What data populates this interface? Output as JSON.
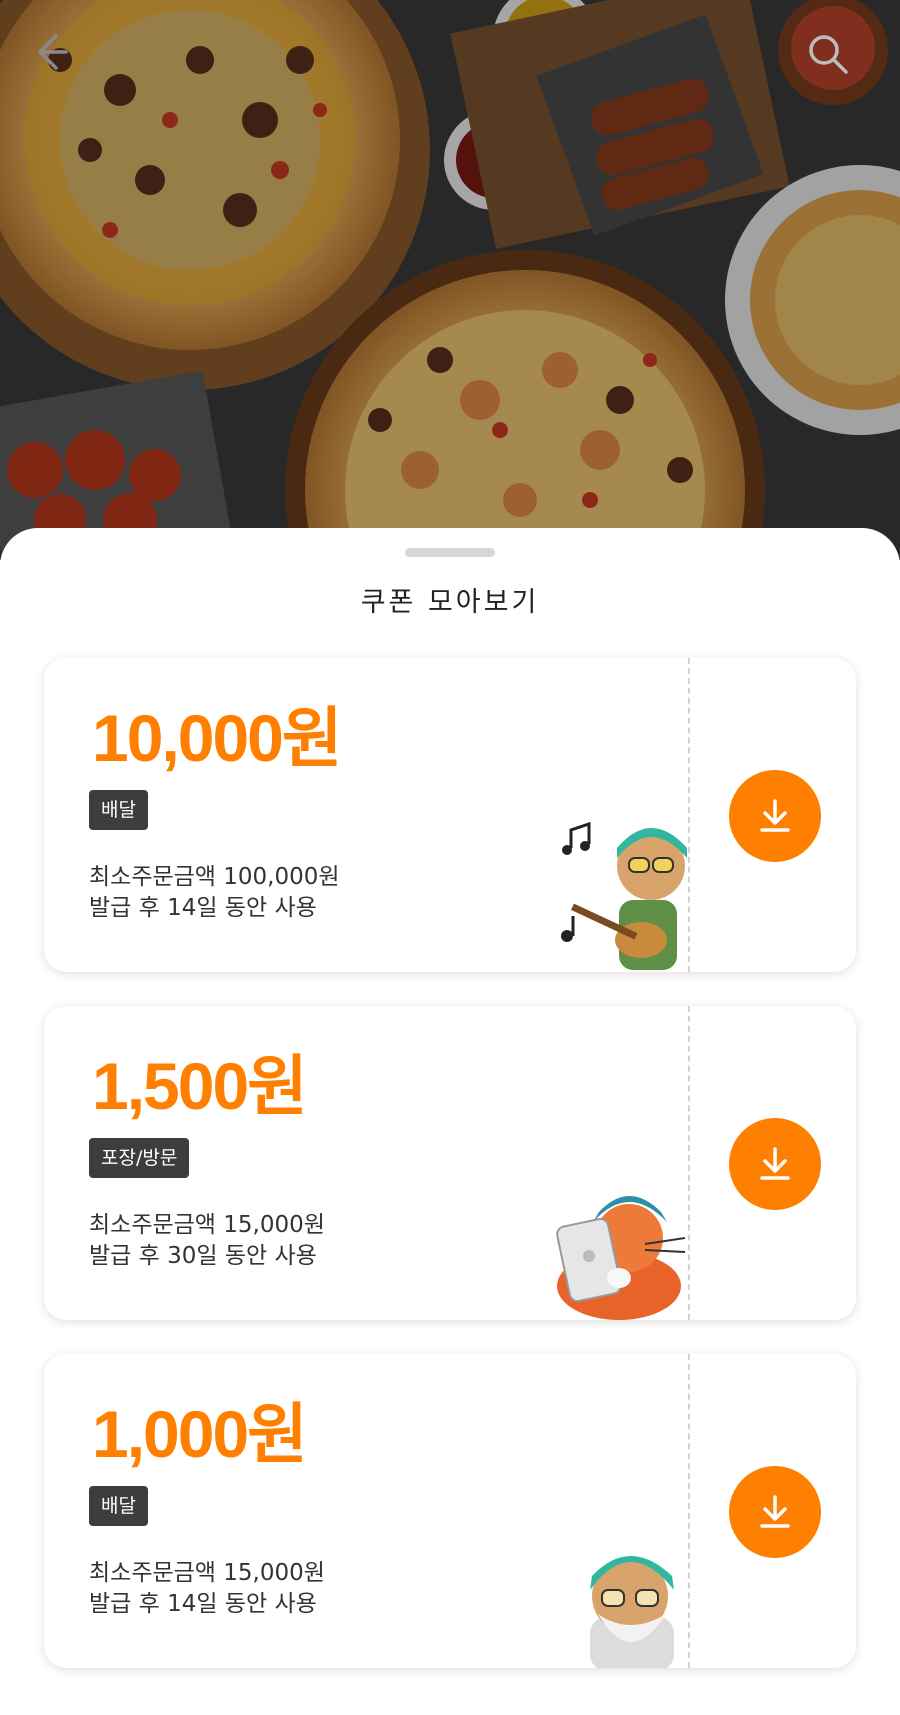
{
  "header": {
    "back_icon": "back-arrow-icon",
    "search_icon": "search-icon"
  },
  "sheet": {
    "title": "쿠폰 모아보기"
  },
  "coupons": [
    {
      "amount": "10,000원",
      "tag": "배달",
      "min_order": "최소주문금액 100,000원",
      "validity": "발급 후 14일 동안 사용",
      "character": "guitar-character-illustration",
      "download_icon": "download-icon"
    },
    {
      "amount": "1,500원",
      "tag": "포장/방문",
      "min_order": "최소주문금액 15,000원",
      "validity": "발급 후 30일 동안 사용",
      "character": "cat-tablet-character-illustration",
      "download_icon": "download-icon"
    },
    {
      "amount": "1,000원",
      "tag": "배달",
      "min_order": "최소주문금액 15,000원",
      "validity": "발급 후 14일 동안 사용",
      "character": "beard-character-illustration",
      "download_icon": "download-icon"
    }
  ],
  "colors": {
    "accent": "#ff7f00",
    "tag_bg": "#3d3d3d",
    "text": "#333333"
  }
}
